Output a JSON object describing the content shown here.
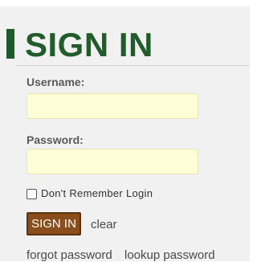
{
  "header": {
    "title": "SIGN IN"
  },
  "form": {
    "username": {
      "label": "Username:",
      "value": "",
      "placeholder": ""
    },
    "password": {
      "label": "Password:",
      "value": "",
      "placeholder": ""
    },
    "remember": {
      "label": "Don't Remember Login",
      "checked": false
    },
    "submit_label": "SIGN IN",
    "clear_label": "clear"
  },
  "links": {
    "forgot": "forgot password",
    "lookup": "lookup password"
  },
  "colors": {
    "title": "#235c2c",
    "accent_bar": "#1e5b2a",
    "button_bg": "#8a4e1c",
    "input_bg": "#fefdd6",
    "panel_bg": "#f1f1f1"
  }
}
